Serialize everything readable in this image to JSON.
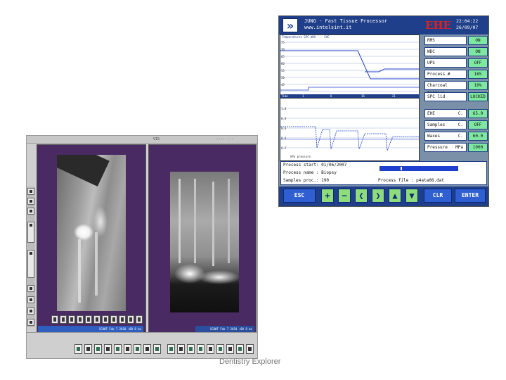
{
  "caption": "Dentistry Explorer",
  "dental_app": {
    "title_left": "VIS",
    "title_right": "----  ---",
    "left_tools": [
      "zoom-icon",
      "rotate-icon",
      "tooth-icon",
      "contrast-icon",
      "ruler-icon",
      "brightness-icon",
      "mirror-icon",
      "measure-icon",
      "print-icon",
      "save-icon"
    ],
    "panel1_status": "SCHWT Feb 7 2010  :00  8 ms",
    "panel2_status": "SCHWT Feb 7 2010  :00  8 ms",
    "bottom_tools": [
      "cursor-icon",
      "zoom-icon",
      "tooth-icon",
      "printer-icon",
      "rotate-icon",
      "pen-icon",
      "arrow-icon",
      "angle-icon",
      "measure-icon",
      "grid-icon",
      "note-icon",
      "compare-icon",
      "chart-icon",
      "filter-icon",
      "export-icon",
      "settings-icon",
      "close-icon",
      "help-icon"
    ]
  },
  "processor": {
    "brand_line1": "JUNG - Fast Tissue Processor",
    "brand_line2": "www.intelsint.it",
    "logo_brand": "EHE",
    "time": "22:04:22",
    "date": "26/09/07",
    "graph1_label": "Temperatures   SPC    WAX ---    CHC",
    "graph1_ticks": [
      "75",
      "70",
      "65",
      "60",
      "55",
      "50",
      "45",
      "40"
    ],
    "axis_label": "Time",
    "axis_ticks": [
      "1",
      "6",
      "16",
      "21"
    ],
    "graph2_label": "kPa pressure",
    "graph2_ticks": [
      "1.0",
      "0.8",
      "0.6",
      "0.4",
      "0.2",
      "0.0"
    ],
    "status": [
      {
        "name": "RMS",
        "value": "ON"
      },
      {
        "name": "WDC",
        "value": "ON"
      },
      {
        "name": "UPS",
        "value": "OFF"
      },
      {
        "name": "Process #",
        "value": "165"
      },
      {
        "name": "Charcoal Filters",
        "value": "10%"
      },
      {
        "name": "SPC lid",
        "value": "LOCKED"
      },
      {
        "name": "EHE",
        "unit": "C.",
        "value": "65.0"
      },
      {
        "name": "Samples",
        "unit": "C.",
        "value": "OFF"
      },
      {
        "name": "Waxes",
        "unit": "C.",
        "value": "60.0"
      },
      {
        "name": "Pressure",
        "unit": "MPa",
        "value": "1000"
      }
    ],
    "info": {
      "start": "Process start: 01/06/2007",
      "name": "Process name : Biopsy",
      "samples": "Samples proc.: 190",
      "file": "Process file : p4ata08.dat"
    },
    "buttons": [
      "ESC",
      "+",
      "−",
      "❮",
      "❯",
      "▲",
      "▼",
      "CLR",
      "ENTER"
    ]
  }
}
